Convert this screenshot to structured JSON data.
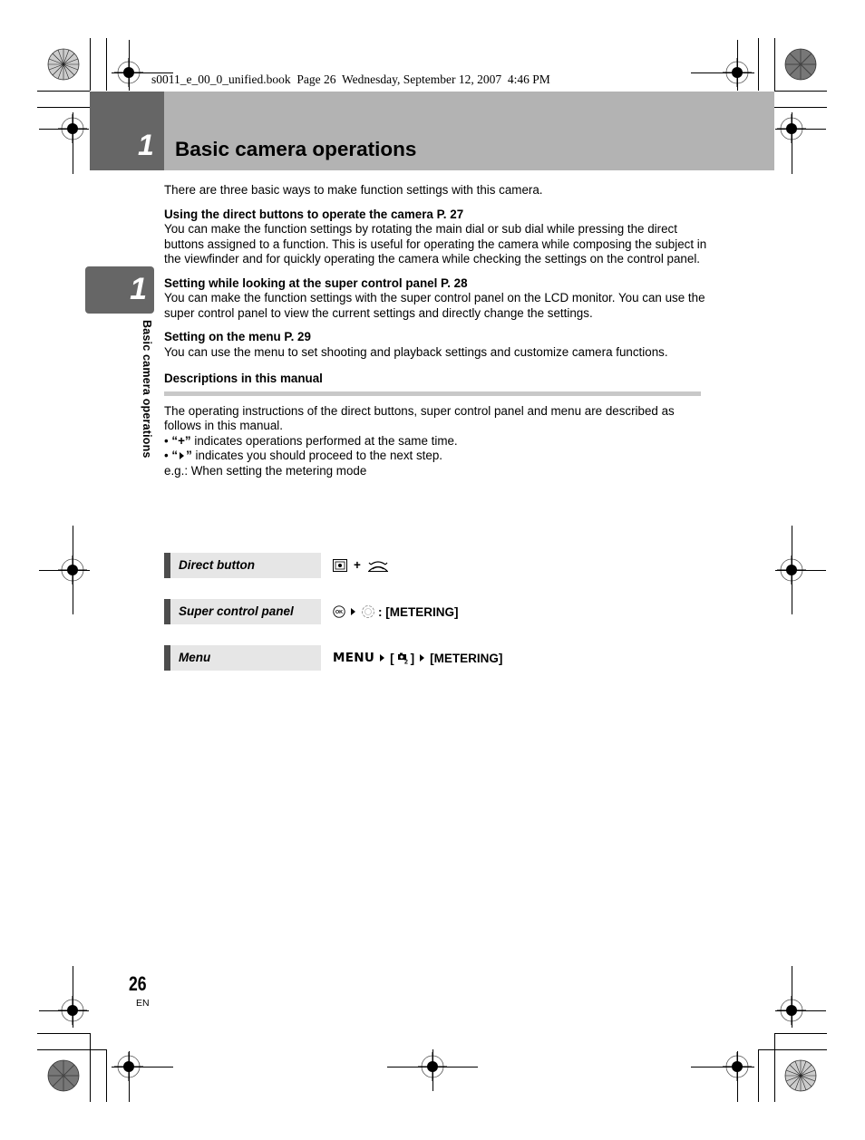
{
  "print_info": "s0011_e_00_0_unified.book  Page 26  Wednesday, September 12, 2007  4:46 PM",
  "header": {
    "chapter_number": "1",
    "title": "Basic camera operations"
  },
  "side_tab": {
    "chapter_number": "1",
    "label": "Basic camera operations"
  },
  "content": {
    "intro": "There are three basic ways to make function settings with this camera.",
    "sections": [
      {
        "heading": "Using the direct buttons to operate the camera P. 27",
        "body": "You can make the function settings by rotating the main dial or sub dial while pressing the direct buttons assigned to a function. This is useful for operating the camera while composing the subject in the viewfinder and for quickly operating the camera while checking the settings on the control panel."
      },
      {
        "heading": "Setting while looking at the super control panel P. 28",
        "body": "You can make the function settings with the super control panel on the LCD monitor. You can use the super control panel to view the current settings and directly change the settings."
      },
      {
        "heading": "Setting on the menu P. 29",
        "body": "You can use the menu to set shooting and playback settings and customize camera functions."
      }
    ],
    "descriptions": {
      "heading": "Descriptions in this manual",
      "body": "The operating instructions of the direct buttons, super control panel and menu are described as follows in this manual.",
      "bullets": [
        {
          "symbol": "“+”",
          "text": " indicates operations performed at the same time."
        },
        {
          "symbol": "“ ”",
          "text": " indicates you should proceed to the next step."
        }
      ]
    },
    "example_caption": "e.g.: When setting the metering mode",
    "examples": [
      {
        "label": "Direct button",
        "icons": [
          "metering-button-icon",
          "dial-icon"
        ],
        "plus": "+"
      },
      {
        "label": "Super control panel",
        "icons": [
          "ok-button-icon",
          "arrow-pad-icon"
        ],
        "value": ": [METERING]"
      },
      {
        "label": "Menu",
        "menu_word": "MENU",
        "tab": "[",
        "tab_sub": "2",
        "tab_close": "]",
        "value": "[METERING]"
      }
    ]
  },
  "footer": {
    "page_number": "26",
    "language": "EN"
  }
}
